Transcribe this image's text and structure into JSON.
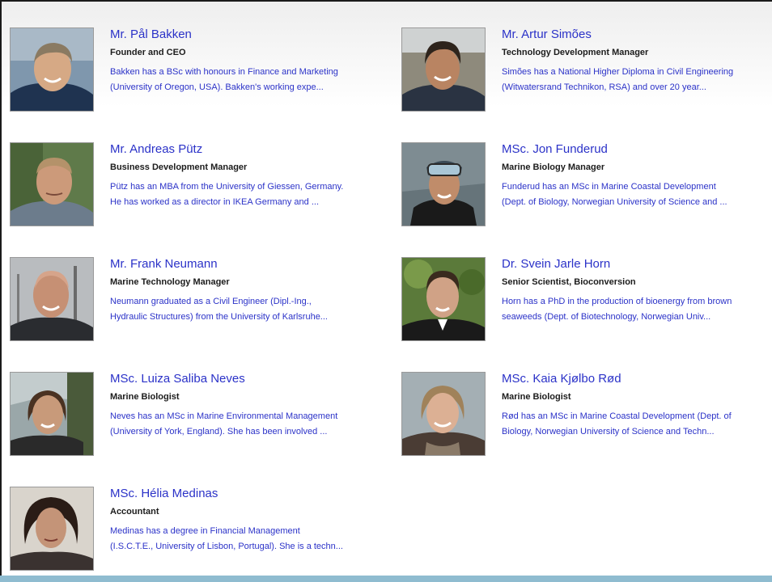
{
  "team": [
    {
      "name": "Mr. Pål Bakken",
      "title": "Founder and CEO",
      "bio_line1": "Bakken has a BSc with honours in Finance and Marketing",
      "bio_line2": "(University of Oregon, USA). Bakken's working expe...",
      "photo": "portrait-bakken"
    },
    {
      "name": "Mr. Artur Simões",
      "title": "Technology Development Manager",
      "bio_line1": "Simões has a National Higher Diploma in Civil Engineering",
      "bio_line2": "(Witwatersrand Technikon, RSA) and over 20 year...",
      "photo": "portrait-simoes"
    },
    {
      "name": "Mr. Andreas Pütz",
      "title": "Business Development Manager",
      "bio_line1": "Pütz has an MBA from the University of Giessen, Germany.",
      "bio_line2": "He has worked as a director in IKEA Germany and ...",
      "photo": "portrait-putz"
    },
    {
      "name": "MSc. Jon Funderud",
      "title": "Marine Biology Manager",
      "bio_line1": "Funderud has an MSc in Marine Coastal Development",
      "bio_line2": "(Dept. of Biology, Norwegian University of Science and ...",
      "photo": "portrait-funderud"
    },
    {
      "name": "Mr. Frank Neumann",
      "title": "Marine Technology Manager",
      "bio_line1": "Neumann graduated as a Civil Engineer (Dipl.-Ing.,",
      "bio_line2": "Hydraulic Structures) from the University of Karlsruhe...",
      "photo": "portrait-neumann"
    },
    {
      "name": "Dr. Svein Jarle Horn",
      "title": "Senior Scientist, Bioconversion",
      "bio_line1": "Horn has a PhD in the production of bioenergy from brown",
      "bio_line2": "seaweeds (Dept. of Biotechnology, Norwegian Univ...",
      "photo": "portrait-horn"
    },
    {
      "name": "MSc. Luiza Saliba Neves",
      "title": "Marine Biologist",
      "bio_line1": "Neves has an MSc in Marine Environmental Management",
      "bio_line2": "(University of York, England). She has been involved ...",
      "photo": "portrait-neves"
    },
    {
      "name": "MSc. Kaia Kjølbo Rød",
      "title": "Marine Biologist",
      "bio_line1": "Rød has an MSc in Marine Coastal Development (Dept. of",
      "bio_line2": "Biology, Norwegian University of Science and Techn...",
      "photo": "portrait-rod"
    },
    {
      "name": "MSc. Hélia Medinas",
      "title": "Accountant",
      "bio_line1": "Medinas has a degree in Financial Management",
      "bio_line2": "(I.S.C.T.E., University of Lisbon, Portugal). She is a techn...",
      "photo": "portrait-medinas"
    }
  ],
  "colors": {
    "link": "#2b32c8",
    "role_text": "#1c1c1c",
    "bottom_bar": "#8fbcd0"
  }
}
